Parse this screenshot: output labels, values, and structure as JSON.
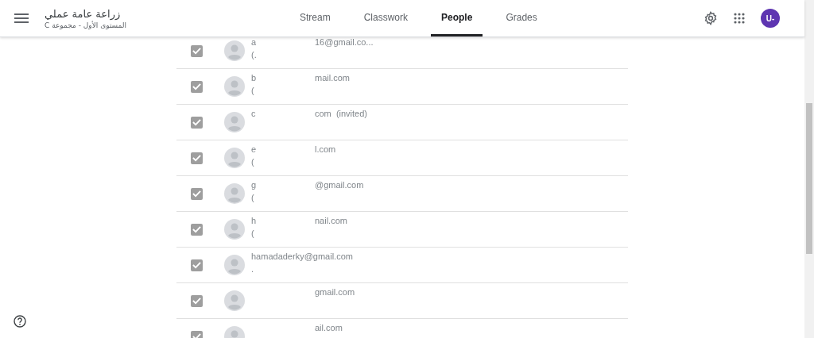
{
  "header": {
    "class_title": "زراعة عامة عملي",
    "class_section": "المستوى الأول - مجموعة C",
    "avatar_initials": "U-"
  },
  "tabs": [
    {
      "label": "Stream",
      "selected": false
    },
    {
      "label": "Classwork",
      "selected": false
    },
    {
      "label": "People",
      "selected": true
    },
    {
      "label": "Grades",
      "selected": false
    }
  ],
  "people": [
    {
      "checked": true,
      "kind": "split",
      "left": "a",
      "right": "16@gmail.co...",
      "sub": "(."
    },
    {
      "checked": true,
      "kind": "split",
      "left": "b",
      "right": "mail.com",
      "sub": "("
    },
    {
      "checked": true,
      "kind": "split",
      "left": "c",
      "right": "com  (invited)"
    },
    {
      "checked": true,
      "kind": "split",
      "left": "e",
      "right": "l.com",
      "sub": "("
    },
    {
      "checked": true,
      "kind": "split",
      "left": "g",
      "right": "@gmail.com",
      "sub": "("
    },
    {
      "checked": true,
      "kind": "split",
      "left": "h",
      "right": "nail.com",
      "sub": "("
    },
    {
      "checked": true,
      "kind": "full",
      "left": "hamadaderky@gmail.com",
      "sub": "."
    },
    {
      "checked": true,
      "kind": "split",
      "right": "gmail.com"
    },
    {
      "checked": true,
      "kind": "split",
      "right": "ail.com"
    }
  ]
}
